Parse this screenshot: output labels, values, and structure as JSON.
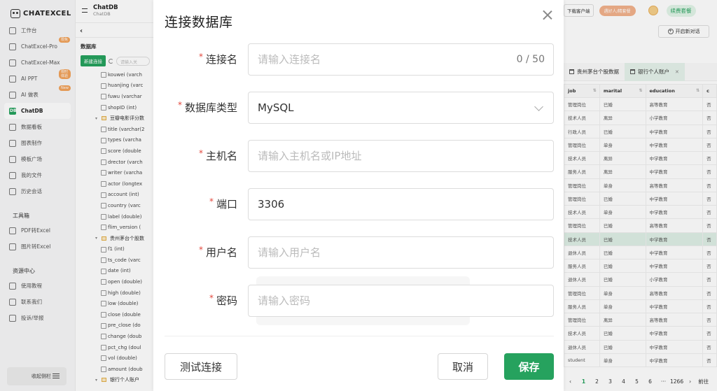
{
  "sidebar": {
    "logo": "CHATEXCEL",
    "items": [
      {
        "label": "工作台",
        "icon": "home-icon"
      },
      {
        "label": "ChatExcel-Pro",
        "icon": "pro-icon",
        "badge": "限免"
      },
      {
        "label": "ChatExcel-Max",
        "icon": "max-icon"
      },
      {
        "label": "AI PPT",
        "icon": "ppt-icon",
        "badge": "限时体验"
      },
      {
        "label": "AI 做表",
        "icon": "table-icon",
        "badge": "New"
      },
      {
        "label": "ChatDB",
        "icon": "db-icon",
        "active": true
      },
      {
        "label": "数据看板",
        "icon": "dashboard-icon"
      },
      {
        "label": "图表制作",
        "icon": "chart-icon"
      },
      {
        "label": "模板广场",
        "icon": "template-icon"
      },
      {
        "label": "我的文件",
        "icon": "file-icon"
      },
      {
        "label": "历史会话",
        "icon": "history-icon"
      }
    ],
    "tools_title": "工具箱",
    "tools": [
      {
        "label": "PDF转Excel",
        "icon": "pdf-icon"
      },
      {
        "label": "图片转Excel",
        "icon": "image-icon"
      }
    ],
    "resources_title": "资源中心",
    "resources": [
      {
        "label": "使用教程",
        "icon": "book-icon"
      },
      {
        "label": "联系我们",
        "icon": "mail-icon"
      },
      {
        "label": "投诉/举报",
        "icon": "report-icon"
      }
    ],
    "collapse_label": "收起侧栏"
  },
  "panel": {
    "title": "ChatDB",
    "subtitle": "ChatDB",
    "section": "数据库",
    "new_button": "新建连接",
    "search_placeholder": "请输入关",
    "tree": [
      {
        "type": "field",
        "label": "kouwei (varch"
      },
      {
        "type": "field",
        "label": "huanjing (varc"
      },
      {
        "type": "field",
        "label": "fuwu (varchar"
      },
      {
        "type": "field",
        "label": "shopID (int)"
      },
      {
        "type": "table",
        "label": "豆瓣电影评分数"
      },
      {
        "type": "field",
        "label": "title (varchar(2"
      },
      {
        "type": "field",
        "label": "types (varcha"
      },
      {
        "type": "field",
        "label": "score (double"
      },
      {
        "type": "field",
        "label": "drector (varch"
      },
      {
        "type": "field",
        "label": "writer (varcha"
      },
      {
        "type": "field",
        "label": "actor (longtex"
      },
      {
        "type": "field",
        "label": "account (int)"
      },
      {
        "type": "field",
        "label": "country (varc"
      },
      {
        "type": "field",
        "label": "label (double)"
      },
      {
        "type": "field",
        "label": "flim_version ("
      },
      {
        "type": "table",
        "label": "贵州茅台个股数"
      },
      {
        "type": "field",
        "label": "f1 (int)"
      },
      {
        "type": "field",
        "label": "ts_code (varc"
      },
      {
        "type": "field",
        "label": "date (int)"
      },
      {
        "type": "field",
        "label": "open (double)"
      },
      {
        "type": "field",
        "label": "high (double)"
      },
      {
        "type": "field",
        "label": "low (double)"
      },
      {
        "type": "field",
        "label": "close (double"
      },
      {
        "type": "field",
        "label": "pre_close (do"
      },
      {
        "type": "field",
        "label": "change (doub"
      },
      {
        "type": "field",
        "label": "pct_chg (doul"
      },
      {
        "type": "field",
        "label": "vol (double)"
      },
      {
        "type": "field",
        "label": "amount (doub"
      },
      {
        "type": "table",
        "label": "银行个人账户"
      }
    ]
  },
  "topbar": {
    "download": "下载客户端",
    "promo": "遇好人/精套餐",
    "renew": "续费套餐",
    "new_chat": "开启新对话"
  },
  "tabs": [
    {
      "label": "贵州茅台个股数据",
      "active": false
    },
    {
      "label": "银行个人账户",
      "active": true
    }
  ],
  "grid": {
    "columns": [
      "job",
      "marital",
      "education",
      "c"
    ],
    "rows": [
      [
        "管理岗位",
        "已婚",
        "高等教育",
        "否"
      ],
      [
        "技术人员",
        "离异",
        "小学教育",
        "否"
      ],
      [
        "行政人员",
        "已婚",
        "中学教育",
        "否"
      ],
      [
        "管理岗位",
        "单身",
        "中学教育",
        "否"
      ],
      [
        "技术人员",
        "离异",
        "中学教育",
        "否"
      ],
      [
        "服务人员",
        "离异",
        "中学教育",
        "否"
      ],
      [
        "管理岗位",
        "单身",
        "高等教育",
        "否"
      ],
      [
        "管理岗位",
        "已婚",
        "中学教育",
        "否"
      ],
      [
        "技术人员",
        "单身",
        "中学教育",
        "否"
      ],
      [
        "管理岗位",
        "已婚",
        "高等教育",
        "否"
      ],
      [
        "技术人员",
        "已婚",
        "中学教育",
        "否"
      ],
      [
        "退休人员",
        "已婚",
        "中学教育",
        "否"
      ],
      [
        "服务人员",
        "已婚",
        "中学教育",
        "否"
      ],
      [
        "退休人员",
        "已婚",
        "小学教育",
        "否"
      ],
      [
        "管理岗位",
        "单身",
        "高等教育",
        "否"
      ],
      [
        "服务人员",
        "单身",
        "中学教育",
        "否"
      ],
      [
        "管理岗位",
        "离异",
        "高等教育",
        "否"
      ],
      [
        "技术人员",
        "已婚",
        "中学教育",
        "否"
      ],
      [
        "退休人员",
        "已婚",
        "中学教育",
        "否"
      ],
      [
        "student",
        "单身",
        "中学教育",
        "否"
      ]
    ],
    "highlight_row": 10
  },
  "pager": {
    "prev": "‹",
    "pages": [
      "1",
      "2",
      "3",
      "4",
      "5",
      "6"
    ],
    "ellipsis": "···",
    "last": "1266",
    "next": "›",
    "tail": "前往"
  },
  "modal": {
    "title": "连接数据库",
    "fields": [
      {
        "label": "连接名",
        "placeholder": "请输入连接名",
        "value": "",
        "counter": "0 / 50"
      },
      {
        "label": "数据库类型",
        "placeholder": "",
        "value": "MySQL",
        "type": "select"
      },
      {
        "label": "主机名",
        "placeholder": "请输入主机名或IP地址",
        "value": ""
      },
      {
        "label": "端口",
        "placeholder": "",
        "value": "3306"
      },
      {
        "label": "用户名",
        "placeholder": "请输入用户名",
        "value": ""
      },
      {
        "label": "密码",
        "placeholder": "请输入密码",
        "value": ""
      }
    ],
    "required_mark": "*",
    "test_button": "测试连接",
    "cancel_button": "取消",
    "save_button": "保存"
  },
  "colors": {
    "accent": "#26a25e",
    "required": "#e2483d",
    "highlight_row": "#dff0e6"
  }
}
